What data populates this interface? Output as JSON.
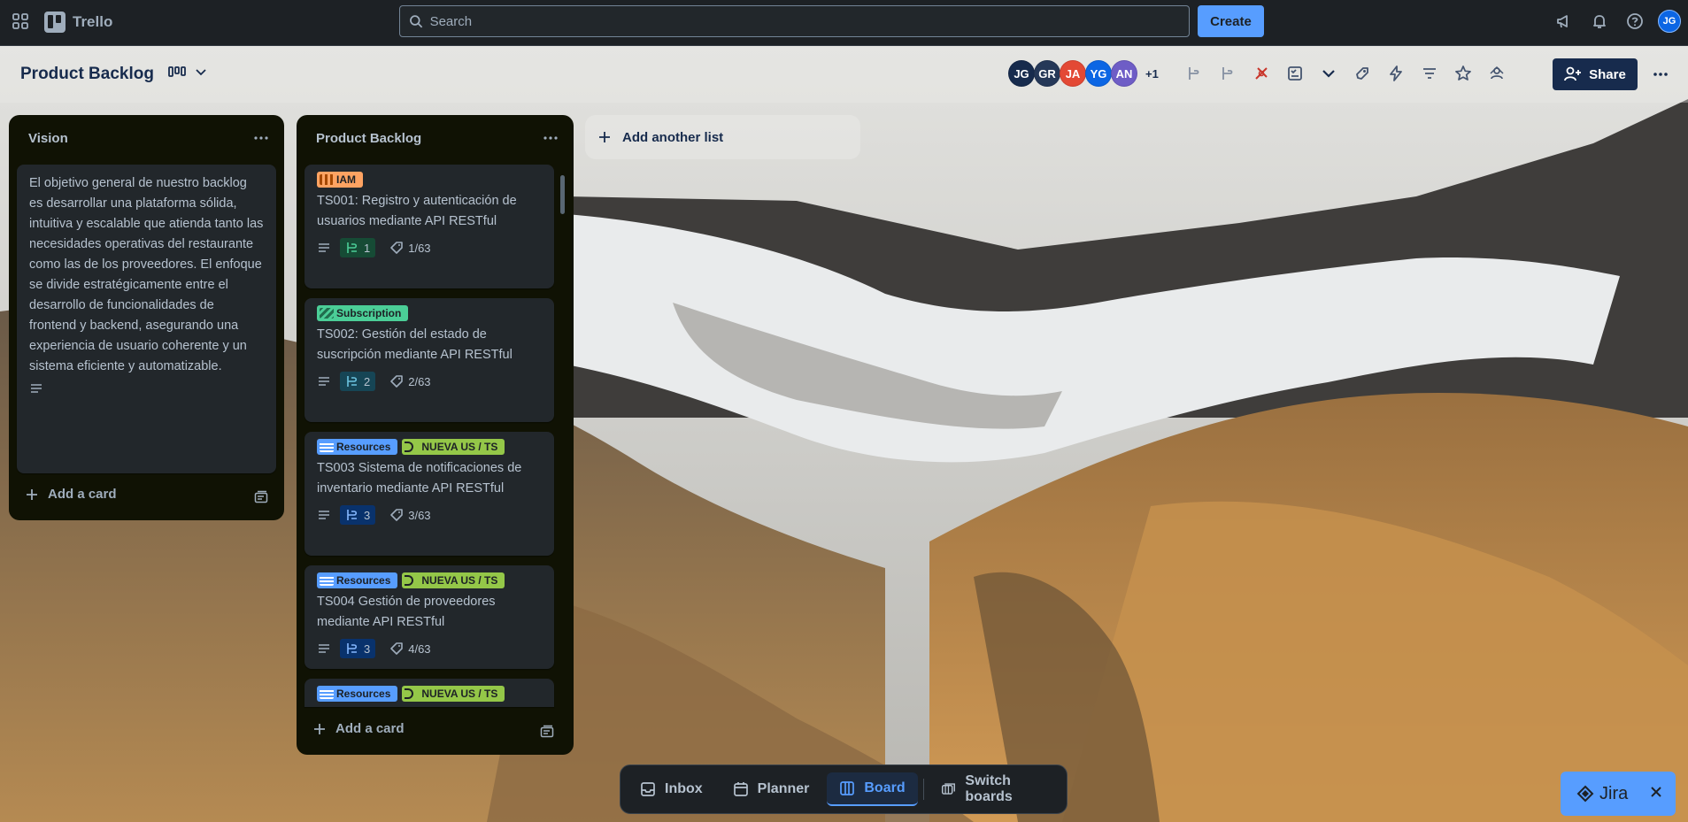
{
  "app": {
    "name": "Trello"
  },
  "search": {
    "placeholder": "Search"
  },
  "topbar": {
    "create_label": "Create",
    "user_initials": "JG"
  },
  "board": {
    "title": "Product Backlog",
    "members": [
      {
        "initials": "JG",
        "color": "#172b4d"
      },
      {
        "initials": "GR",
        "color": "#253858"
      },
      {
        "initials": "JA",
        "color": "#e34935"
      },
      {
        "initials": "YG",
        "color": "#0c66e4"
      },
      {
        "initials": "AN",
        "color": "#6e5dc6"
      }
    ],
    "extra_members": "+1",
    "share_label": "Share",
    "add_list_label": "Add another list"
  },
  "lists": [
    {
      "title": "Vision",
      "cards": [
        {
          "text": "El objetivo general de nuestro backlog es desarrollar una plataforma sólida, intuitiva y escalable que atienda tanto las necesidades operativas del restaurante como las de los proveedores. El enfoque se divide estratégicamente entre el desarrollo de funcionalidades de frontend y backend, asegurando una experiencia de usuario coherente y un sistema eficiente y automatizable."
        }
      ],
      "add_card_label": "Add a card"
    },
    {
      "title": "Product Backlog",
      "cards": [
        {
          "labels": [
            {
              "text": "IAM",
              "color": "#fea362"
            }
          ],
          "title": "TS001: Registro y autenticación de usuarios mediante API RESTful",
          "subtasks": "1",
          "checklist": "1/63"
        },
        {
          "labels": [
            {
              "text": "Subscription",
              "color": "#4bce97"
            }
          ],
          "title": "TS002: Gestión del estado de suscripción mediante API RESTful",
          "subtasks": "2",
          "checklist": "2/63"
        },
        {
          "labels": [
            {
              "text": "Resources",
              "color": "#579dff"
            },
            {
              "text": "NUEVA US / TS",
              "color": "#94c748"
            }
          ],
          "title": "TS003 Sistema de notificaciones de inventario mediante API RESTful",
          "subtasks": "3",
          "checklist": "3/63"
        },
        {
          "labels": [
            {
              "text": "Resources",
              "color": "#579dff"
            },
            {
              "text": "NUEVA US / TS",
              "color": "#94c748"
            }
          ],
          "title": "TS004 Gestión de proveedores mediante API RESTful",
          "subtasks": "3",
          "checklist": "4/63"
        },
        {
          "labels": [
            {
              "text": "Resources",
              "color": "#579dff"
            },
            {
              "text": "NUEVA US / TS",
              "color": "#94c748"
            }
          ]
        }
      ],
      "add_card_label": "Add a card"
    }
  ],
  "bottom_nav": {
    "inbox": "Inbox",
    "planner": "Planner",
    "board": "Board",
    "switch": "Switch boards"
  },
  "jira": {
    "label": "Jira"
  }
}
